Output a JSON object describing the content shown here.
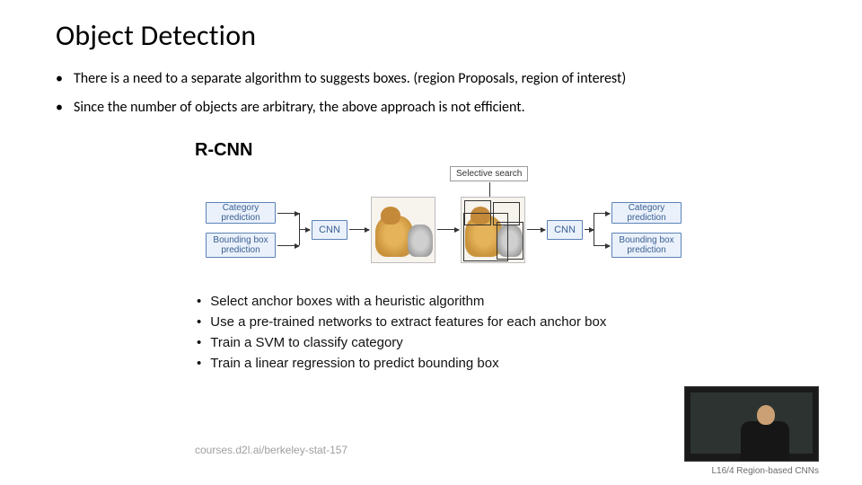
{
  "title": "Object Detection",
  "bullets": [
    "There is a need to a separate algorithm to suggests boxes. (region Proposals, region of interest)",
    "Since the number of objects are arbitrary, the above approach is not efficient."
  ],
  "sub": {
    "title": "R-CNN",
    "ss_label": "Selective search",
    "boxes": {
      "cat_pred_left": "Category prediction",
      "bbox_pred_left": "Bounding box prediction",
      "cnn_left": "CNN",
      "cnn_right": "CNN",
      "cat_pred_right": "Category prediction",
      "bbox_pred_right": "Bounding box prediction"
    },
    "sub_bullets": [
      "Select anchor boxes with a heuristic algorithm",
      "Use a pre-trained networks to extract features for each anchor box",
      "Train a SVM to classify category",
      "Train a linear regression to predict bounding box"
    ],
    "footer": "courses.d2l.ai/berkeley-stat-157"
  },
  "caption": "L16/4 Region-based CNNs"
}
